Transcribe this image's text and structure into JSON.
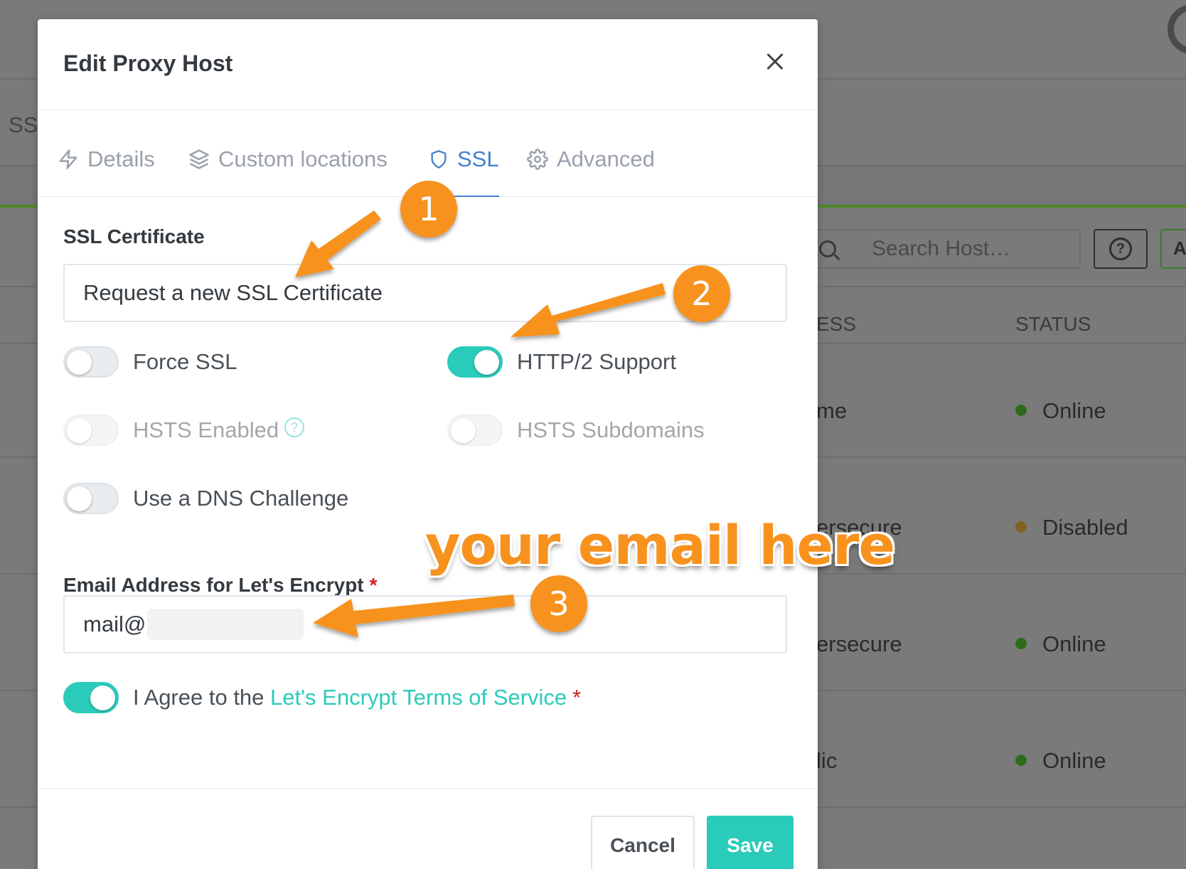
{
  "background": {
    "tab_fragment": "SSL",
    "search_placeholder": "Search Host…",
    "help_glyph": "?",
    "add_fragment": "A",
    "columns": {
      "address_fragment": "ESS",
      "status": "STATUS"
    },
    "rows": [
      {
        "address_fragment": "me",
        "status": "Online",
        "status_color": "#2d6b1b"
      },
      {
        "address_fragment": "ersecure",
        "status": "Disabled",
        "status_color": "#7e6420"
      },
      {
        "address_fragment": "ersecure",
        "status": "Online",
        "status_color": "#2d6b1b"
      },
      {
        "address_fragment": "lic",
        "status": "Online",
        "status_color": "#2d6b1b"
      }
    ]
  },
  "modal": {
    "title": "Edit Proxy Host",
    "tabs": [
      {
        "label": "Details",
        "icon": "zap-icon",
        "active": false
      },
      {
        "label": "Custom locations",
        "icon": "layers-icon",
        "active": false
      },
      {
        "label": "SSL",
        "icon": "shield-icon",
        "active": true
      },
      {
        "label": "Advanced",
        "icon": "gear-icon",
        "active": false
      }
    ],
    "ssl_certificate": {
      "label": "SSL Certificate",
      "value": "Request a new SSL Certificate"
    },
    "toggles": {
      "force_ssl": {
        "label": "Force SSL",
        "on": false,
        "disabled": false
      },
      "http2": {
        "label": "HTTP/2 Support",
        "on": true,
        "disabled": false
      },
      "hsts_enabled": {
        "label": "HSTS Enabled",
        "on": false,
        "disabled": true
      },
      "hsts_subdomains": {
        "label": "HSTS Subdomains",
        "on": false,
        "disabled": true
      },
      "dns_challenge": {
        "label": "Use a DNS Challenge",
        "on": false,
        "disabled": false
      }
    },
    "email": {
      "label": "Email Address for Let's Encrypt",
      "required_mark": "*",
      "value": "mail@"
    },
    "agree": {
      "prefix": "I Agree to the ",
      "link_text": "Let's Encrypt Terms of Service",
      "required_mark": "*",
      "on": true
    },
    "buttons": {
      "cancel": "Cancel",
      "save": "Save"
    }
  },
  "annotations": {
    "badges": [
      "1",
      "2",
      "3"
    ],
    "note": "your email here",
    "color": "#f7921e"
  },
  "colors": {
    "accent_teal": "#2bcbba",
    "tab_active_blue": "#467fcf",
    "required_red": "#cd201f"
  }
}
